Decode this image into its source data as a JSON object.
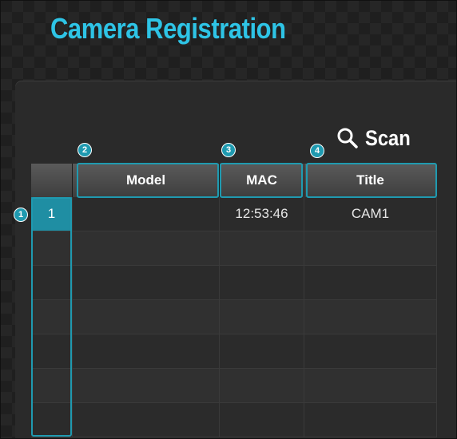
{
  "window": {
    "title": "Camera Registration"
  },
  "toolbar": {
    "scan_label": "Scan",
    "scan_icon": "search-icon"
  },
  "table": {
    "columns": [
      "Model",
      "MAC",
      "Title"
    ],
    "rows": [
      {
        "index": "1",
        "model": "",
        "mac": "12:53:46",
        "title": "CAM1"
      },
      {
        "index": "",
        "model": "",
        "mac": "",
        "title": ""
      },
      {
        "index": "",
        "model": "",
        "mac": "",
        "title": ""
      },
      {
        "index": "",
        "model": "",
        "mac": "",
        "title": ""
      },
      {
        "index": "",
        "model": "",
        "mac": "",
        "title": ""
      },
      {
        "index": "",
        "model": "",
        "mac": "",
        "title": ""
      },
      {
        "index": "",
        "model": "",
        "mac": "",
        "title": ""
      }
    ]
  },
  "callouts": [
    "1",
    "2",
    "3",
    "4"
  ],
  "colors": {
    "accent": "#2ec4e6",
    "highlight": "#1f9ab0",
    "background": "#1f1f1f"
  }
}
